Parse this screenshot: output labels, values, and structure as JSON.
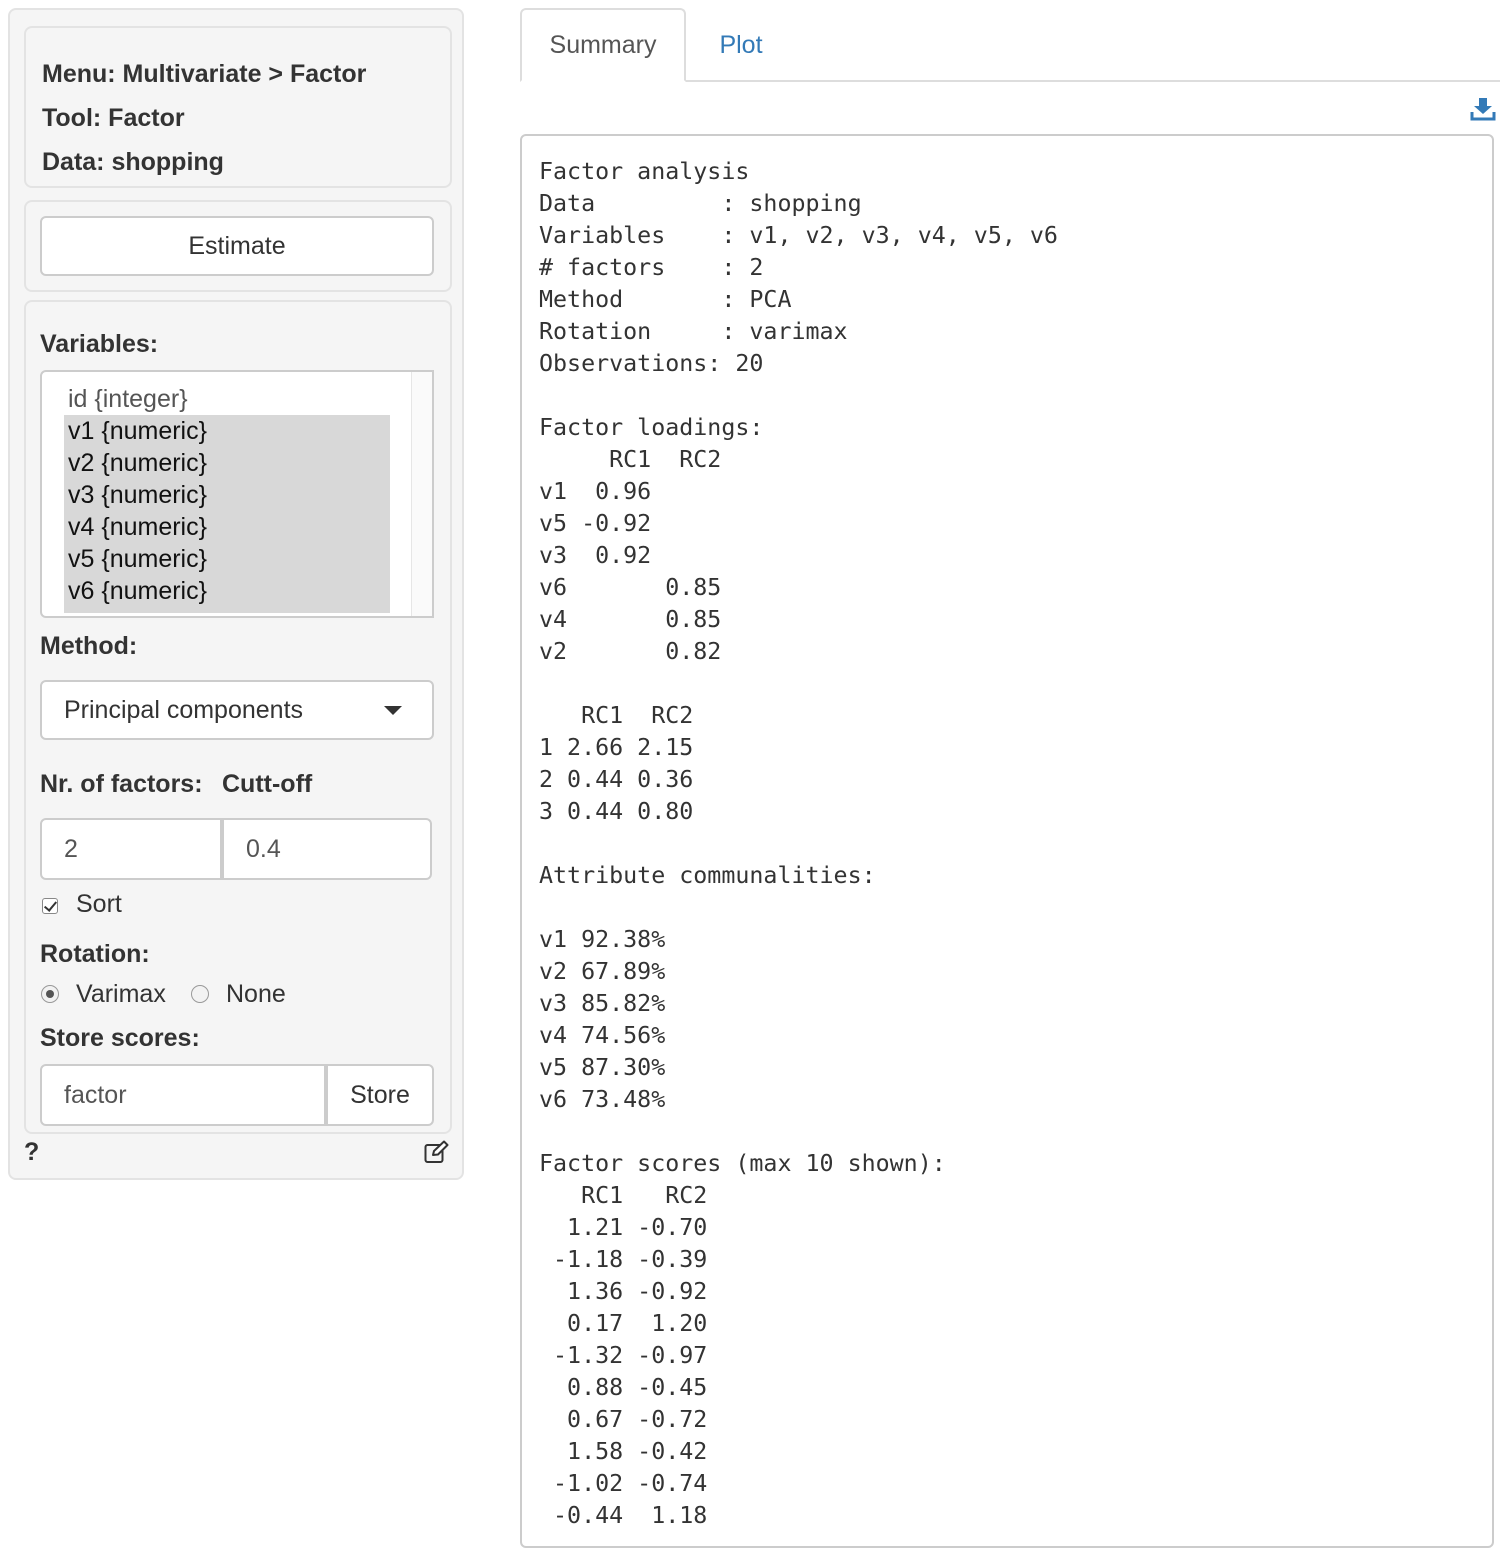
{
  "sidebar": {
    "info": {
      "menu": "Menu: Multivariate > Factor",
      "tool": "Tool: Factor",
      "data": "Data: shopping"
    },
    "estimate_label": "Estimate",
    "variables_label": "Variables:",
    "variables": [
      {
        "label": "id {integer}",
        "selected": false
      },
      {
        "label": "v1 {numeric}",
        "selected": true
      },
      {
        "label": "v2 {numeric}",
        "selected": true
      },
      {
        "label": "v3 {numeric}",
        "selected": true
      },
      {
        "label": "v4 {numeric}",
        "selected": true
      },
      {
        "label": "v5 {numeric}",
        "selected": true
      },
      {
        "label": "v6 {numeric}",
        "selected": true
      }
    ],
    "method_label": "Method:",
    "method_value": "Principal components",
    "nr_factors_label": "Nr. of factors:",
    "nr_factors_value": "2",
    "cutoff_label": "Cutt-off",
    "cutoff_value": "0.4",
    "sort_label": "Sort",
    "sort_checked": true,
    "rotation_label": "Rotation:",
    "rotation_options": [
      "Varimax",
      "None"
    ],
    "rotation_selected": "Varimax",
    "store_scores_label": "Store scores:",
    "store_name_value": "factor",
    "store_button_label": "Store",
    "help_label": "?"
  },
  "tabs": [
    {
      "label": "Summary",
      "active": true
    },
    {
      "label": "Plot",
      "active": false
    }
  ],
  "output_text": "Factor analysis\nData         : shopping\nVariables    : v1, v2, v3, v4, v5, v6\n# factors    : 2\nMethod       : PCA\nRotation     : varimax\nObservations: 20\n\nFactor loadings:\n     RC1  RC2\nv1  0.96\nv5 -0.92\nv3  0.92\nv6       0.85\nv4       0.85\nv2       0.82\n\n   RC1  RC2\n1 2.66 2.15\n2 0.44 0.36\n3 0.44 0.80\n\nAttribute communalities:\n\nv1 92.38%\nv2 67.89%\nv3 85.82%\nv4 74.56%\nv5 87.30%\nv6 73.48%\n\nFactor scores (max 10 shown):\n   RC1   RC2\n  1.21 -0.70\n -1.18 -0.39\n  1.36 -0.92\n  0.17  1.20\n -1.32 -0.97\n  0.88 -0.45\n  0.67 -0.72\n  1.58 -0.42\n -1.02 -0.74\n -0.44  1.18",
  "icons": {
    "download": "download-icon",
    "edit": "edit-icon",
    "help": "help-icon"
  },
  "colors": {
    "link": "#337ab7",
    "selected_option": "#d8d8d8",
    "well_bg": "#f5f5f5"
  }
}
